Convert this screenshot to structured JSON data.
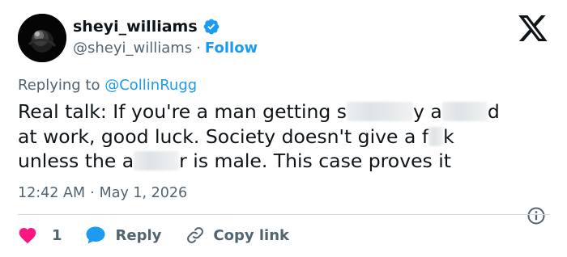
{
  "author": {
    "display_name": "sheyi_williams",
    "handle": "@sheyi_williams",
    "separator": "·",
    "follow_label": "Follow",
    "verified": true
  },
  "reply_context": {
    "prefix": "Replying to",
    "mention": "@CollinRugg"
  },
  "tweet": {
    "segments": [
      "Real talk: If you're a man getting s",
      "y a",
      "d",
      "at work, good luck. Society doesn't give a f",
      "k",
      "unless the a",
      "r is male. This case proves it"
    ]
  },
  "meta": {
    "time": "12:42 AM",
    "separator": "·",
    "date": "May 1, 2026"
  },
  "actions": {
    "like_count": "1",
    "reply_label": "Reply",
    "copy_link_label": "Copy link"
  },
  "colors": {
    "accent": "#1d9bf0",
    "like": "#f91880",
    "text": "#0f1419",
    "secondary": "#536471",
    "divider": "#cfd9de"
  },
  "icons": [
    "verified-badge-icon",
    "x-logo-icon",
    "info-icon",
    "heart-icon",
    "reply-bubble-icon",
    "link-icon"
  ]
}
